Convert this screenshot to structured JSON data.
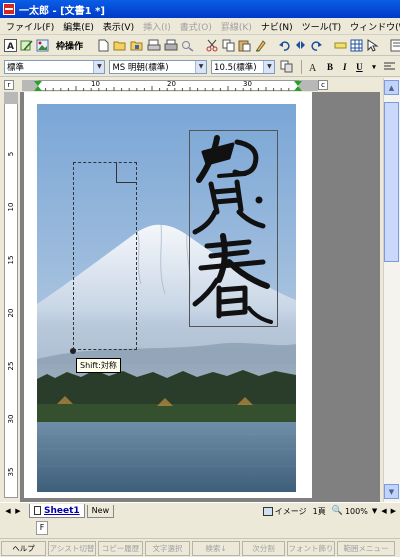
{
  "window": {
    "title": "一太郎 - [文書1 *]"
  },
  "menu": [
    {
      "label": "ファイル(F)",
      "enabled": true
    },
    {
      "label": "編集(E)",
      "enabled": true
    },
    {
      "label": "表示(V)",
      "enabled": true
    },
    {
      "label": "挿入(I)",
      "enabled": false
    },
    {
      "label": "書式(O)",
      "enabled": false
    },
    {
      "label": "罫線(K)",
      "enabled": false
    },
    {
      "label": "ナビ(N)",
      "enabled": true
    },
    {
      "label": "ツール(T)",
      "enabled": true
    },
    {
      "label": "ウィンドウ(W)",
      "enabled": true
    }
  ],
  "toolbar1": {
    "frame_operation_label": "枠操作"
  },
  "toolbar2": {
    "style_value": "標準",
    "font_value": "MS 明朝(標準)",
    "size_value": "10.5(標準)",
    "bold": "B",
    "italic": "I",
    "underline": "U"
  },
  "ruler": {
    "corner_left": "r",
    "corner_right": "c",
    "h_labels": [
      "10",
      "20",
      "30"
    ],
    "v_labels": [
      "5",
      "10",
      "15",
      "20",
      "25",
      "30",
      "35"
    ]
  },
  "document": {
    "tooltip": "Shift:対称",
    "greeting": "賀春"
  },
  "tabs": {
    "sheet1": "Sheet1",
    "new": "New",
    "image_status": "イメージ",
    "page_count": "1頁",
    "zoom": "100%"
  },
  "input_row": {
    "value": "F"
  },
  "function_keys": [
    {
      "label": "ヘルプ",
      "enabled": true
    },
    {
      "label": "アシスト切替",
      "enabled": false
    },
    {
      "label": "コピー履歴",
      "enabled": false
    },
    {
      "label": "文字選択",
      "enabled": false
    },
    {
      "label": "検索↓",
      "enabled": false
    },
    {
      "label": "次分割",
      "enabled": false
    },
    {
      "label": "フォント飾り",
      "enabled": false
    },
    {
      "label": "範囲メニュー",
      "enabled": false
    }
  ],
  "colors": {
    "titlebar": "#0a5ee6",
    "sky_top": "#7aa6d6",
    "lake": "#4c6f8a"
  }
}
